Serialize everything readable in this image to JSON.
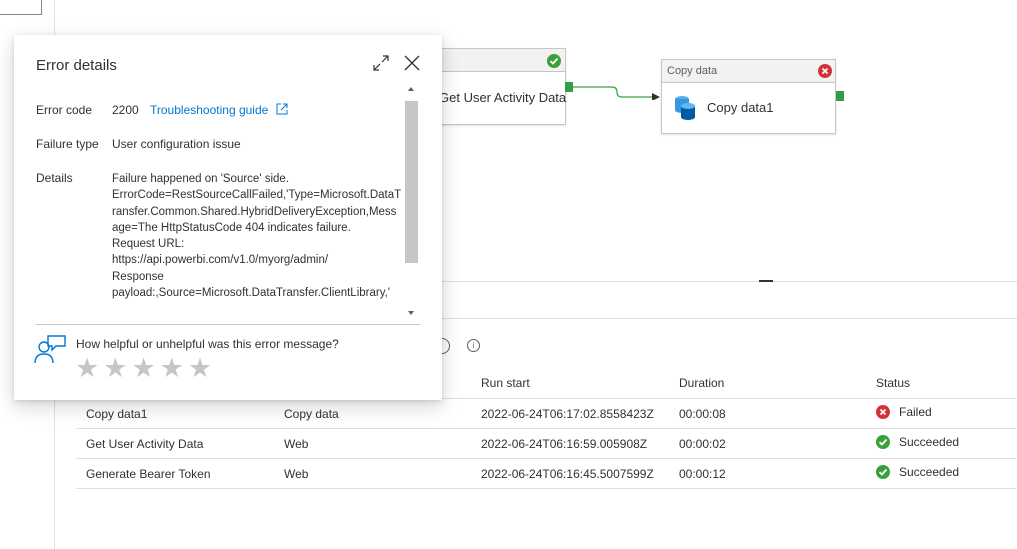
{
  "pipeline": {
    "web_activity": {
      "label": "Get User Activity Data",
      "status": "succeeded"
    },
    "copy_activity": {
      "type_label": "Copy data",
      "label": "Copy data1",
      "status": "failed"
    }
  },
  "error_panel": {
    "title": "Error details",
    "error_code_label": "Error code",
    "error_code_value": "2200",
    "troubleshooting_link": "Troubleshooting guide",
    "failure_type_label": "Failure type",
    "failure_type_value": "User configuration issue",
    "details_label": "Details",
    "details_lines": [
      "Failure happened on 'Source' side.",
      "ErrorCode=RestSourceCallFailed,'Type=Microsoft.DataT",
      "ransfer.Common.Shared.HybridDeliveryException,Mess",
      "age=The HttpStatusCode 404 indicates failure.",
      "Request URL:",
      "https://api.powerbi.com/v1.0/myorg/admin/",
      "Response",
      "payload:,Source=Microsoft.DataTransfer.ClientLibrary,'"
    ],
    "feedback_question": "How helpful or unhelpful was this error message?",
    "star_count": 5
  },
  "runs_table": {
    "headers": {
      "run_start": "Run start",
      "duration": "Duration",
      "status": "Status"
    },
    "rows": [
      {
        "name": "Copy data1",
        "type": "Copy data",
        "run_start": "2022-06-24T06:17:02.8558423Z",
        "duration": "00:00:08",
        "status": "Failed"
      },
      {
        "name": "Get User Activity Data",
        "type": "Web",
        "run_start": "2022-06-24T06:16:59.005908Z",
        "duration": "00:00:02",
        "status": "Succeeded"
      },
      {
        "name": "Generate Bearer Token",
        "type": "Web",
        "run_start": "2022-06-24T06:16:45.5007599Z",
        "duration": "00:00:12",
        "status": "Succeeded"
      }
    ]
  },
  "colors": {
    "success": "#3aa13a",
    "error": "#d13438",
    "link": "#0078d4",
    "star": "#c8c6c4"
  }
}
